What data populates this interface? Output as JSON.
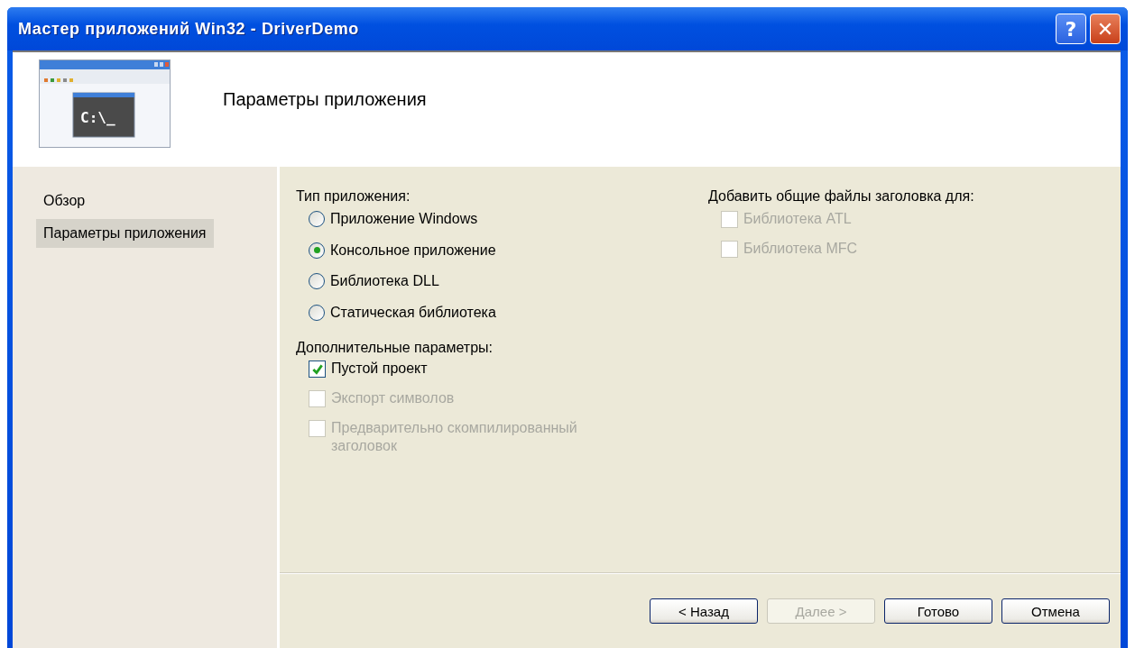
{
  "window": {
    "title": "Мастер приложений Win32 - DriverDemo",
    "help_button": "?",
    "close_button": "✕"
  },
  "header": {
    "title": "Параметры приложения",
    "icon_text": "C:\\_"
  },
  "sidebar": {
    "items": [
      {
        "label": "Обзор",
        "selected": false
      },
      {
        "label": "Параметры приложения",
        "selected": true
      }
    ]
  },
  "application_type": {
    "label": "Тип приложения:",
    "options": [
      {
        "label": "Приложение Windows",
        "selected": false
      },
      {
        "label": "Консольное приложение",
        "selected": true
      },
      {
        "label": "Библиотека DLL",
        "selected": false
      },
      {
        "label": "Статическая библиотека",
        "selected": false
      }
    ]
  },
  "additional_options": {
    "label": "Дополнительные параметры:",
    "options": [
      {
        "label": "Пустой проект",
        "checked": true,
        "disabled": false
      },
      {
        "label": "Экспорт символов",
        "checked": false,
        "disabled": true
      },
      {
        "label": "Предварительно скомпилированный заголовок",
        "checked": false,
        "disabled": true
      }
    ]
  },
  "common_headers": {
    "label": "Добавить общие файлы заголовка для:",
    "options": [
      {
        "label": "Библиотека ATL",
        "checked": false,
        "disabled": true
      },
      {
        "label": "Библиотека MFC",
        "checked": false,
        "disabled": true
      }
    ]
  },
  "buttons": [
    {
      "label": "< Назад",
      "disabled": false
    },
    {
      "label": "Далее >",
      "disabled": true
    },
    {
      "label": "Готово",
      "disabled": false
    },
    {
      "label": "Отмена",
      "disabled": false
    }
  ]
}
